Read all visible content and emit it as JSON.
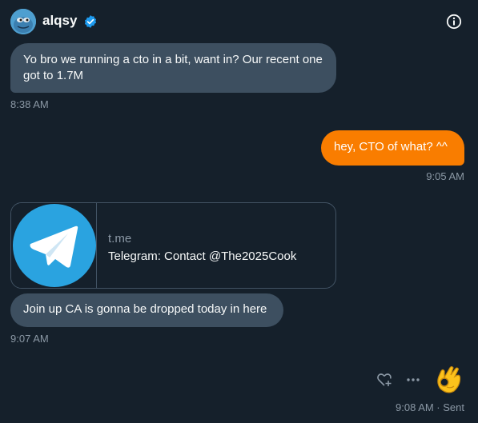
{
  "header": {
    "username": "alqsy",
    "avatar_icon": "pepe-avatar",
    "verified_icon": "verified-badge-icon",
    "info_icon": "info-icon"
  },
  "messages": [
    {
      "direction": "received",
      "text": "Yo bro we running a cto in a bit, want in? Our recent one got to 1.7M",
      "time": "8:38 AM"
    },
    {
      "direction": "sent",
      "text": "hey, CTO of what? ^^",
      "time": "9:05 AM"
    },
    {
      "direction": "received",
      "type": "link-card",
      "domain": "t.me",
      "title": "Telegram: Contact @The2025Cook",
      "thumbnail_icon": "telegram-logo"
    },
    {
      "direction": "received",
      "text": "Join up CA is gonna be dropped today in here",
      "time": "9:07 AM"
    },
    {
      "direction": "sent",
      "type": "emoji",
      "emoji": "ok-hand",
      "time": "9:08 AM · Sent"
    }
  ],
  "colors": {
    "background": "#15202b",
    "received_bubble": "#3d4f60",
    "sent_bubble": "#f97d00",
    "verified": "#1d9bf0",
    "telegram": "#2aa3e0",
    "muted_text": "#8b98a5"
  }
}
